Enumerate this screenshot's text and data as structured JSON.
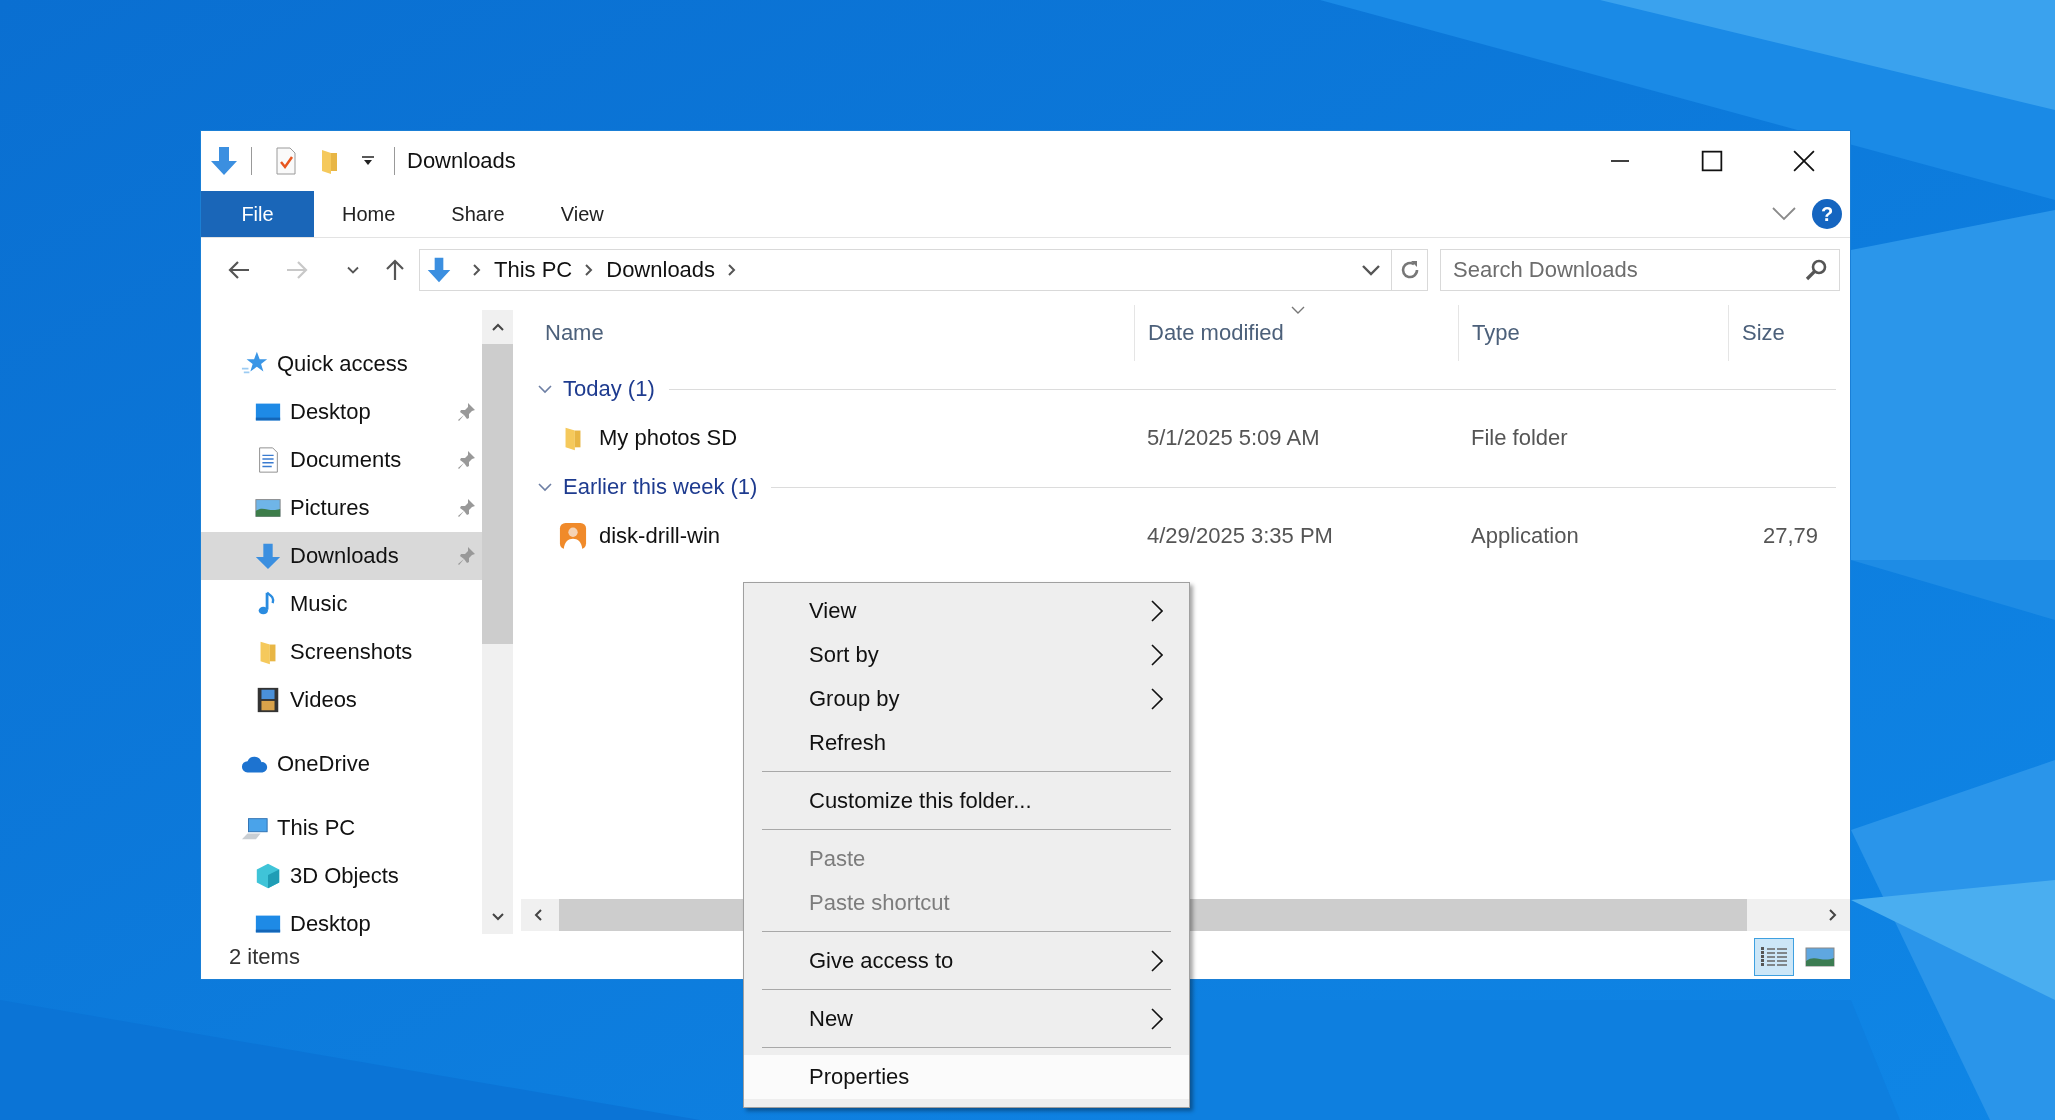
{
  "window": {
    "title": "Downloads"
  },
  "ribbon": {
    "tabs": [
      {
        "label": "File",
        "selected": true
      },
      {
        "label": "Home",
        "selected": false
      },
      {
        "label": "Share",
        "selected": false
      },
      {
        "label": "View",
        "selected": false
      }
    ],
    "help": "?"
  },
  "address": {
    "crumbs": [
      "This PC",
      "Downloads"
    ],
    "search_placeholder": "Search Downloads"
  },
  "nav": [
    {
      "label": "Quick access",
      "kind": "star",
      "pinned": false,
      "selected": false,
      "children": [
        {
          "label": "Desktop",
          "kind": "desktop",
          "pinned": true,
          "selected": false
        },
        {
          "label": "Documents",
          "kind": "documents",
          "pinned": true,
          "selected": false
        },
        {
          "label": "Pictures",
          "kind": "pictures",
          "pinned": true,
          "selected": false
        },
        {
          "label": "Downloads",
          "kind": "downloads",
          "pinned": true,
          "selected": true
        },
        {
          "label": "Music",
          "kind": "music",
          "pinned": false,
          "selected": false
        },
        {
          "label": "Screenshots",
          "kind": "folder",
          "pinned": false,
          "selected": false
        },
        {
          "label": "Videos",
          "kind": "videos",
          "pinned": false,
          "selected": false
        }
      ]
    },
    {
      "label": "OneDrive",
      "kind": "cloud",
      "pinned": false,
      "selected": false
    },
    {
      "label": "This PC",
      "kind": "pc",
      "pinned": false,
      "selected": false,
      "children": [
        {
          "label": "3D Objects",
          "kind": "cube",
          "pinned": false,
          "selected": false
        },
        {
          "label": "Desktop",
          "kind": "desktop",
          "pinned": false,
          "selected": false
        }
      ]
    }
  ],
  "columns": [
    "Name",
    "Date modified",
    "Type",
    "Size"
  ],
  "groups": [
    {
      "label": "Today (1)",
      "expanded": true,
      "rows": [
        {
          "name": "My photos SD",
          "kind": "folder",
          "date": "5/1/2025 5:09 AM",
          "type": "File folder"
        }
      ]
    },
    {
      "label": "Earlier this week (1)",
      "expanded": true,
      "rows": [
        {
          "name": "disk-drill-win",
          "kind": "app",
          "date": "4/29/2025 3:35 PM",
          "type": "Application",
          "size": "27,79"
        }
      ]
    }
  ],
  "status": {
    "count": "2 items",
    "views": [
      {
        "kind": "details",
        "selected": true
      },
      {
        "kind": "tiles",
        "selected": false
      }
    ]
  },
  "menu": [
    {
      "kind": "item",
      "label": "View",
      "submenu": true,
      "disabled": false,
      "selected": false
    },
    {
      "kind": "item",
      "label": "Sort by",
      "submenu": true,
      "disabled": false,
      "selected": false
    },
    {
      "kind": "item",
      "label": "Group by",
      "submenu": true,
      "disabled": false,
      "selected": false
    },
    {
      "kind": "item",
      "label": "Refresh",
      "submenu": false,
      "disabled": false,
      "selected": false
    },
    {
      "kind": "separator"
    },
    {
      "kind": "item",
      "label": "Customize this folder...",
      "submenu": false,
      "disabled": false,
      "selected": false
    },
    {
      "kind": "separator"
    },
    {
      "kind": "item",
      "label": "Paste",
      "submenu": false,
      "disabled": true,
      "selected": false
    },
    {
      "kind": "item",
      "label": "Paste shortcut",
      "submenu": false,
      "disabled": true,
      "selected": false
    },
    {
      "kind": "separator"
    },
    {
      "kind": "item",
      "label": "Give access to",
      "submenu": true,
      "disabled": false,
      "selected": false
    },
    {
      "kind": "separator"
    },
    {
      "kind": "item",
      "label": "New",
      "submenu": true,
      "disabled": false,
      "selected": false
    },
    {
      "kind": "separator"
    },
    {
      "kind": "item",
      "label": "Properties",
      "submenu": false,
      "disabled": false,
      "selected": true
    }
  ]
}
